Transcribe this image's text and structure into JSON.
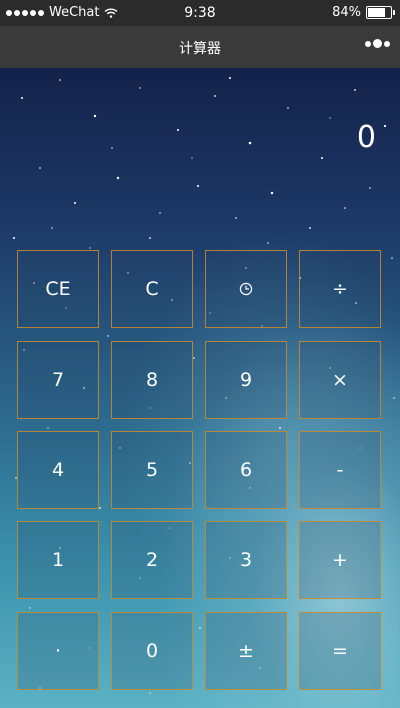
{
  "status_bar": {
    "carrier": "WeChat",
    "time": "9:38",
    "battery": "84%",
    "battery_level": 0.84
  },
  "nav": {
    "title": "计算器"
  },
  "display": {
    "value": "0"
  },
  "keys": {
    "ce": "CE",
    "c": "C",
    "history": "history-clock-icon",
    "divide": "÷",
    "seven": "7",
    "eight": "8",
    "nine": "9",
    "multiply": "×",
    "four": "4",
    "five": "5",
    "six": "6",
    "minus": "-",
    "one": "1",
    "two": "2",
    "three": "3",
    "plus": "+",
    "dot": "·",
    "zero": "0",
    "sign": "±",
    "equals": "="
  },
  "colors": {
    "key_border": "#cd8c28",
    "nav_bg": "#3a3a3a",
    "status_bg": "#2b2b2b"
  }
}
